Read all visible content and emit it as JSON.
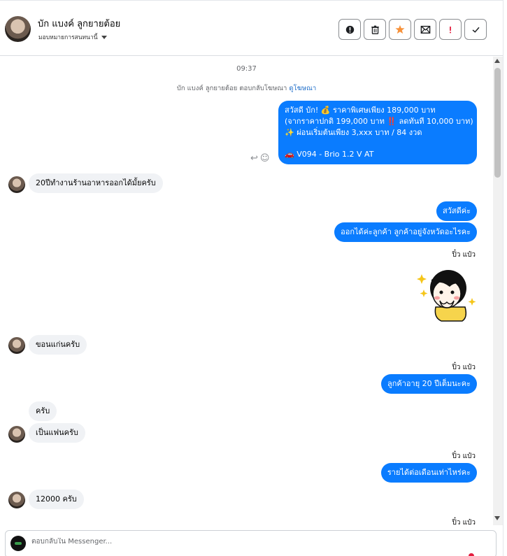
{
  "header": {
    "name": "บัก แบงค์ ลูกยายต้อย",
    "assign_label": "มอบหมายการสนทนานี้",
    "actions": [
      {
        "name": "report-icon",
        "glyph": "!"
      },
      {
        "name": "trash-icon",
        "glyph": "🗑"
      },
      {
        "name": "star-icon",
        "glyph": "★",
        "color": "#f7923a"
      },
      {
        "name": "mail-unread-icon",
        "glyph": "✉"
      },
      {
        "name": "spam-icon",
        "glyph": "!",
        "color": "#e41e3f"
      },
      {
        "name": "done-icon",
        "glyph": "✓"
      }
    ]
  },
  "chat": {
    "timestamp": "09:37",
    "reply_note": "บัก แบงค์ ลูกยายต้อย ตอบกลับโฆษณา",
    "reply_link": "ดูโฆษณา",
    "ad_message": {
      "line1": "สวัสดี บัก! 💰 ราคาพิเศษเพียง 189,000 บาท",
      "line2": "(จากราคาปกติ 199,000 บาท ‼️ ลดทันที 10,000 บาท)",
      "line3": "✨ ผ่อนเริ่มต้นเพียง 3,xxx บาท / 84 งวด",
      "line4": "🚗 V094 - Brio 1.2 V AT"
    },
    "incoming": [
      "20ปีทำงานร้านอาหารออกได้มั้ยครับ",
      "ขอนแก่นครับ",
      "ครับ",
      "เป็นแฟนครับ",
      "12000 ครับ"
    ],
    "outgoing": [
      "สวัสดีค่ะ",
      "ออกได้ค่ะลูกค้า  ลูกค้าอยู่จังหวัดอะไรคะ",
      "ลูกค้าอายุ 20 ปีเต็มนะคะ",
      "รายได้ต่อเดือนเท่าไหร่คะ"
    ],
    "agent_name": "ปิ๋ว แป๋ว",
    "colors": {
      "outgoing": "#0a7cff",
      "incoming": "#f0f2f5"
    }
  },
  "composer": {
    "placeholder": "ตอบกลับใน Messenger..."
  }
}
